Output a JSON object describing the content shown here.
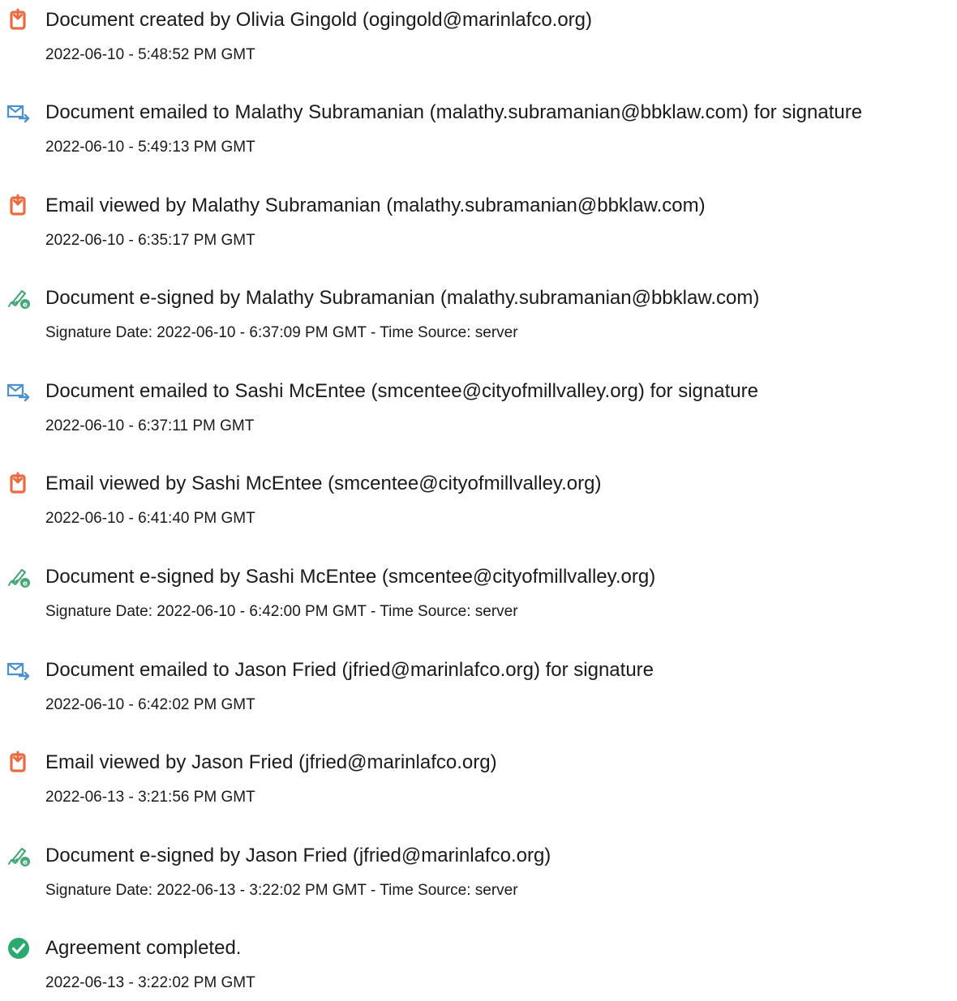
{
  "colors": {
    "doc_icon": "#EC6A3F",
    "mail_icon": "#4B8FD4",
    "sign_icon": "#45A678",
    "check_icon": "#2BAA6E",
    "text": "#1A1A1A"
  },
  "events": [
    {
      "icon": "document-icon",
      "title": "Document created by Olivia Gingold (ogingold@marinlafco.org)",
      "time": "2022-06-10 - 5:48:52 PM GMT"
    },
    {
      "icon": "email-sent-icon",
      "title": "Document emailed to Malathy Subramanian (malathy.subramanian@bbklaw.com) for signature",
      "time": "2022-06-10 - 5:49:13 PM GMT"
    },
    {
      "icon": "document-icon",
      "title": "Email viewed by Malathy Subramanian (malathy.subramanian@bbklaw.com)",
      "time": "2022-06-10 - 6:35:17 PM GMT"
    },
    {
      "icon": "esign-pen-icon",
      "title": "Document e-signed by Malathy Subramanian (malathy.subramanian@bbklaw.com)",
      "time": "Signature Date: 2022-06-10 - 6:37:09 PM GMT - Time Source: server"
    },
    {
      "icon": "email-sent-icon",
      "title": "Document emailed to Sashi McEntee (smcentee@cityofmillvalley.org) for signature",
      "time": "2022-06-10 - 6:37:11 PM GMT"
    },
    {
      "icon": "document-icon",
      "title": "Email viewed by Sashi McEntee (smcentee@cityofmillvalley.org)",
      "time": "2022-06-10 - 6:41:40 PM GMT"
    },
    {
      "icon": "esign-pen-icon",
      "title": "Document e-signed by Sashi McEntee (smcentee@cityofmillvalley.org)",
      "time": "Signature Date: 2022-06-10 - 6:42:00 PM GMT - Time Source: server"
    },
    {
      "icon": "email-sent-icon",
      "title": "Document emailed to Jason Fried (jfried@marinlafco.org) for signature",
      "time": "2022-06-10 - 6:42:02 PM GMT"
    },
    {
      "icon": "document-icon",
      "title": "Email viewed by Jason Fried (jfried@marinlafco.org)",
      "time": "2022-06-13 - 3:21:56 PM GMT"
    },
    {
      "icon": "esign-pen-icon",
      "title": "Document e-signed by Jason Fried (jfried@marinlafco.org)",
      "time": "Signature Date: 2022-06-13 - 3:22:02 PM GMT - Time Source: server"
    },
    {
      "icon": "check-circle-icon",
      "title": "Agreement completed.",
      "time": "2022-06-13 - 3:22:02 PM GMT"
    }
  ]
}
